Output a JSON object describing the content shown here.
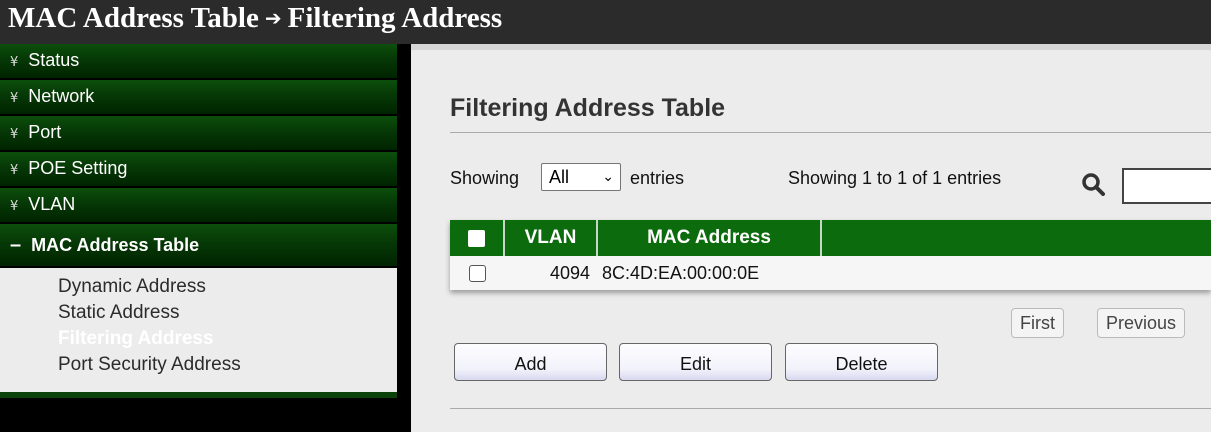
{
  "header": {
    "title_part1": "MAC Address Table",
    "arrow_icon": "right-arrow-icon",
    "title_part2": "Filtering Address"
  },
  "sidebar": {
    "items": [
      {
        "label": "Status"
      },
      {
        "label": "Network"
      },
      {
        "label": "Port"
      },
      {
        "label": "POE Setting"
      },
      {
        "label": "VLAN"
      }
    ],
    "open_item": {
      "label": "MAC Address Table"
    },
    "sub_items": [
      {
        "label": "Dynamic Address"
      },
      {
        "label": "Static Address"
      },
      {
        "label": "Filtering Address",
        "active": true
      },
      {
        "label": "Port Security Address"
      }
    ]
  },
  "main": {
    "title": "Filtering Address Table",
    "showing_label": "Showing",
    "entries_select": {
      "selected": "All"
    },
    "entries_label": "entries",
    "info_text": "Showing 1 to 1 of 1 entries",
    "table": {
      "columns": [
        "VLAN",
        "MAC Address"
      ],
      "rows": [
        {
          "vlan": "4094",
          "mac": "8C:4D:EA:00:00:0E",
          "checked": false
        }
      ]
    },
    "pager": {
      "first": "First",
      "previous": "Previous"
    },
    "buttons": {
      "add": "Add",
      "edit": "Edit",
      "delete": "Delete"
    }
  },
  "colors": {
    "menu_green": "#063806",
    "table_header_green": "#0c6b0c",
    "titlebar": "#2b2b2b"
  }
}
